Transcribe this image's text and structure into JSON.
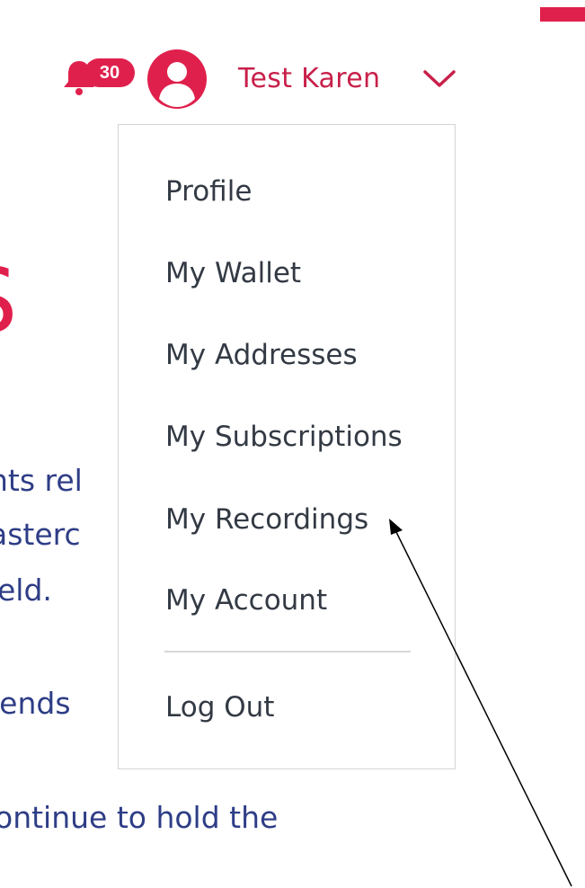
{
  "header": {
    "notification_count": "30",
    "user_name": "Test Karen"
  },
  "background": {
    "heading_fragment": "S",
    "lines": [
      "nts rel",
      "asterc",
      "eld.",
      "iends",
      "ontinue to hold the"
    ]
  },
  "dropdown": {
    "items": [
      {
        "label": "Profile"
      },
      {
        "label": "My Wallet"
      },
      {
        "label": "My Addresses"
      },
      {
        "label": "My Subscriptions"
      },
      {
        "label": "My Recordings"
      },
      {
        "label": "My Account"
      }
    ],
    "logout_label": "Log Out"
  },
  "colors": {
    "accent": "#e0204c",
    "body_text": "#2e3d86",
    "menu_text": "#333a44"
  },
  "icons": [
    "bell-icon",
    "avatar-icon",
    "chevron-down-icon"
  ]
}
